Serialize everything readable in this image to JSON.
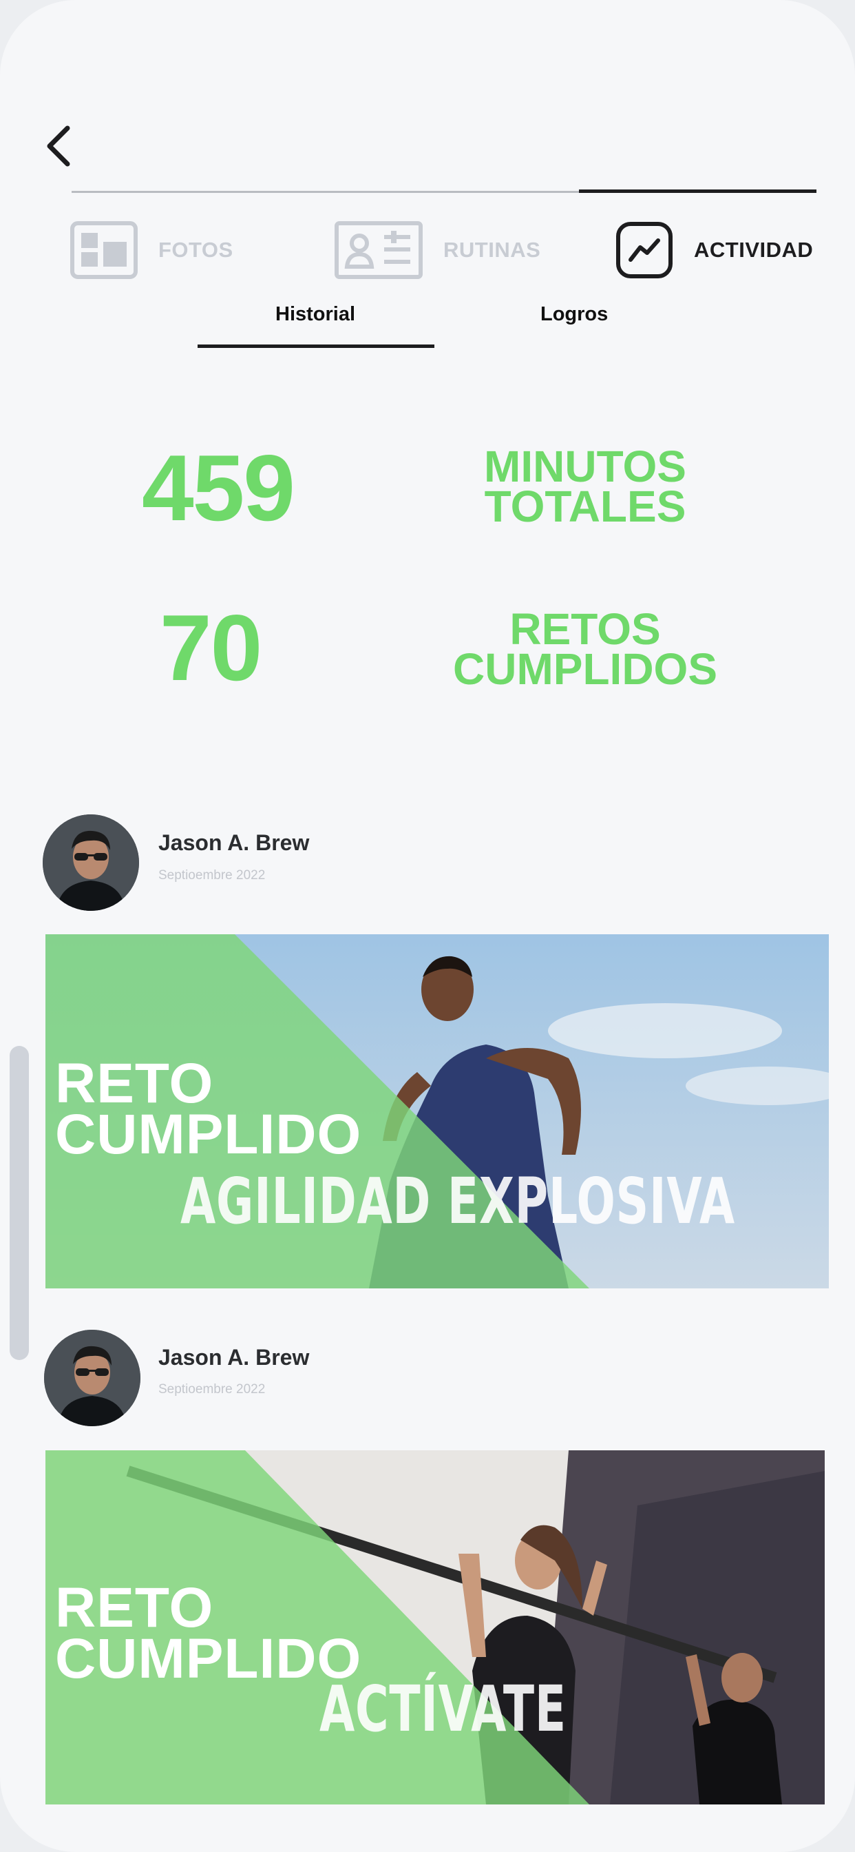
{
  "tabs": [
    {
      "label": "FOTOS",
      "icon": "photos-layout-icon",
      "active": false
    },
    {
      "label": "RUTINAS",
      "icon": "routine-card-icon",
      "active": false
    },
    {
      "label": "ACTIVIDAD",
      "icon": "activity-chart-icon",
      "active": true
    }
  ],
  "subtabs": [
    {
      "label": "Historial",
      "active": true
    },
    {
      "label": "Logros",
      "active": false
    }
  ],
  "stats": [
    {
      "value": "459",
      "label_line1": "MINUTOS",
      "label_line2": "TOTALES"
    },
    {
      "value": "70",
      "label_line1": "RETOS",
      "label_line2": "CUMPLIDOS"
    }
  ],
  "feed": [
    {
      "user_name": "Jason A. Brew",
      "date": "Septioembre 2022",
      "badge_line1": "RETO",
      "badge_line2": "CUMPLIDO",
      "challenge": "AGILIDAD EXPLOSIVA"
    },
    {
      "user_name": "Jason A. Brew",
      "date": "Septioembre 2022",
      "badge_line1": "RETO",
      "badge_line2": "CUMPLIDO",
      "challenge": "ACTÍVATE"
    }
  ],
  "colors": {
    "accent_green": "#6fd96a",
    "text_dark": "#1d1d1f",
    "inactive_gray": "#c8ccd3",
    "background": "#f6f7f9"
  }
}
